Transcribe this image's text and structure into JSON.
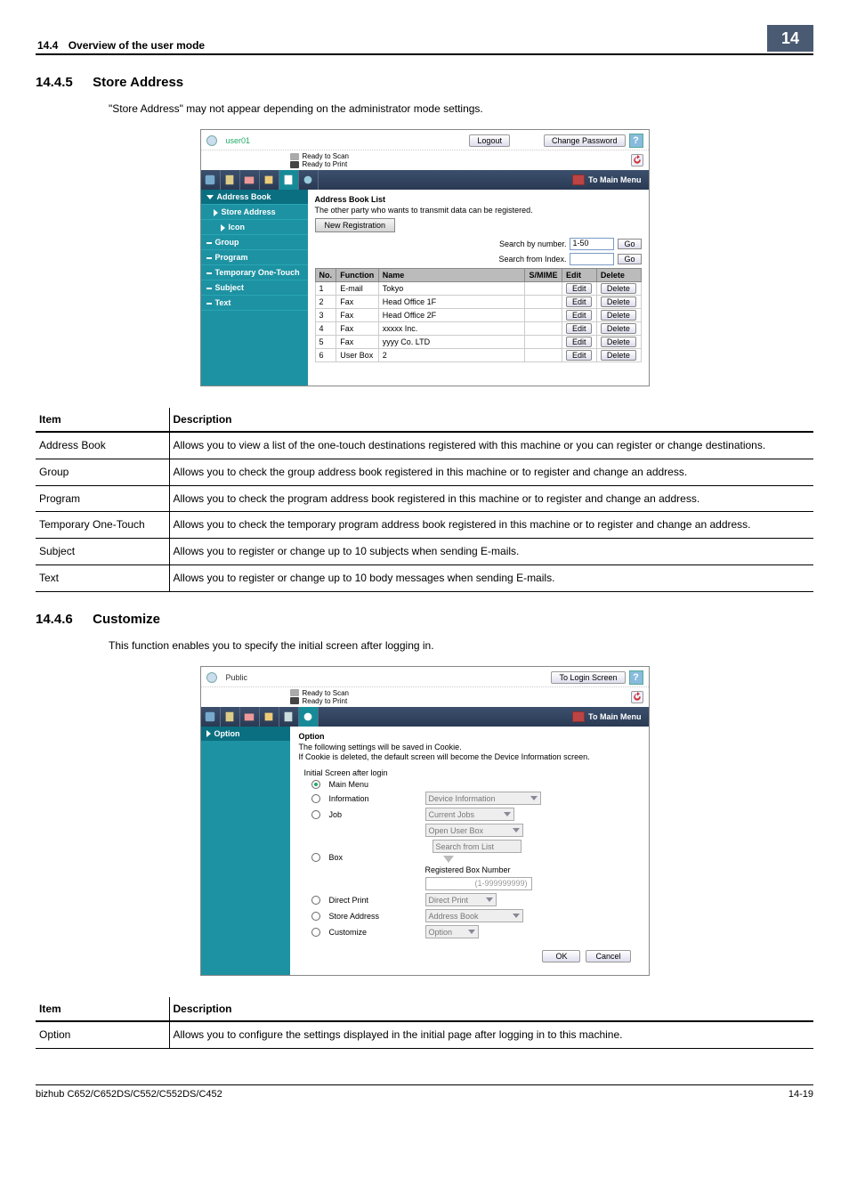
{
  "header": {
    "section_num": "14.4",
    "section_title": "Overview of the user mode",
    "chapter_badge": "14"
  },
  "section1": {
    "num": "14.4.5",
    "title": "Store Address",
    "intro": "\"Store Address\" may not appear depending on the administrator mode settings."
  },
  "screenshot1": {
    "username": "user01",
    "logout": "Logout",
    "change_pw": "Change Password",
    "help": "?",
    "status_scan": "Ready to Scan",
    "status_print": "Ready to Print",
    "main_menu": "To Main Menu",
    "side": {
      "address_book": "Address Book",
      "store_address": "Store Address",
      "icon": "Icon",
      "group": "Group",
      "program": "Program",
      "temp": "Temporary One-Touch",
      "subject": "Subject",
      "text": "Text"
    },
    "main": {
      "title": "Address Book List",
      "note": "The other party who wants to transmit data can be registered.",
      "new_reg": "New Registration",
      "search_num": "Search by number.",
      "search_idx": "Search from Index.",
      "range": "1-50",
      "go": "Go",
      "cols": {
        "no": "No.",
        "func": "Function",
        "name": "Name",
        "smime": "S/MIME",
        "edit": "Edit",
        "del": "Delete"
      },
      "btn": {
        "edit": "Edit",
        "del": "Delete"
      },
      "rows": [
        {
          "no": "1",
          "func": "E-mail",
          "name": "Tokyo"
        },
        {
          "no": "2",
          "func": "Fax",
          "name": "Head Office 1F"
        },
        {
          "no": "3",
          "func": "Fax",
          "name": "Head Office 2F"
        },
        {
          "no": "4",
          "func": "Fax",
          "name": "xxxxx Inc."
        },
        {
          "no": "5",
          "func": "Fax",
          "name": "yyyy Co. LTD"
        },
        {
          "no": "6",
          "func": "User Box",
          "name": "2"
        }
      ]
    }
  },
  "table1": {
    "head_item": "Item",
    "head_desc": "Description",
    "rows": [
      {
        "item": "Address Book",
        "desc": "Allows you to view a list of the one-touch destinations registered with this machine or you can register or change destinations."
      },
      {
        "item": "Group",
        "desc": "Allows you to check the group address book registered in this machine or to register and change an address."
      },
      {
        "item": "Program",
        "desc": "Allows you to check the program address book registered in this machine or to register and change an address."
      },
      {
        "item": "Temporary One-Touch",
        "desc": "Allows you to check the temporary program address book registered in this machine or to register and change an address."
      },
      {
        "item": "Subject",
        "desc": "Allows you to register or change up to 10 subjects when sending E-mails."
      },
      {
        "item": "Text",
        "desc": "Allows you to register or change up to 10 body messages when sending E-mails."
      }
    ]
  },
  "section2": {
    "num": "14.4.6",
    "title": "Customize",
    "intro": "This function enables you to specify the initial screen after logging in."
  },
  "screenshot2": {
    "public": "Public",
    "login": "To Login Screen",
    "help": "?",
    "status_scan": "Ready to Scan",
    "status_print": "Ready to Print",
    "main_menu": "To Main Menu",
    "side_option": "Option",
    "main": {
      "title": "Option",
      "note1": "The following settings will be saved in Cookie.",
      "note2": "If Cookie is deleted, the default screen will become the Device Information screen.",
      "initial": "Initial Screen after login",
      "r_main": "Main Menu",
      "r_info": "Information",
      "dd_info": "Device Information",
      "r_job": "Job",
      "dd_job": "Current Jobs",
      "r_box": "Box",
      "dd_box1": "Open User Box",
      "dd_box2": "Search from List",
      "regbox_lbl": "Registered Box Number",
      "regbox_ph": "(1-999999999)",
      "r_dp": "Direct Print",
      "dd_dp": "Direct Print",
      "r_sa": "Store Address",
      "dd_sa": "Address Book",
      "r_cust": "Customize",
      "dd_cust": "Option",
      "ok": "OK",
      "cancel": "Cancel"
    }
  },
  "table2": {
    "head_item": "Item",
    "head_desc": "Description",
    "rows": [
      {
        "item": "Option",
        "desc": "Allows you to configure the settings displayed in the initial page after logging in to this machine."
      }
    ]
  },
  "footer": {
    "model": "bizhub C652/C652DS/C552/C552DS/C452",
    "page": "14-19"
  }
}
